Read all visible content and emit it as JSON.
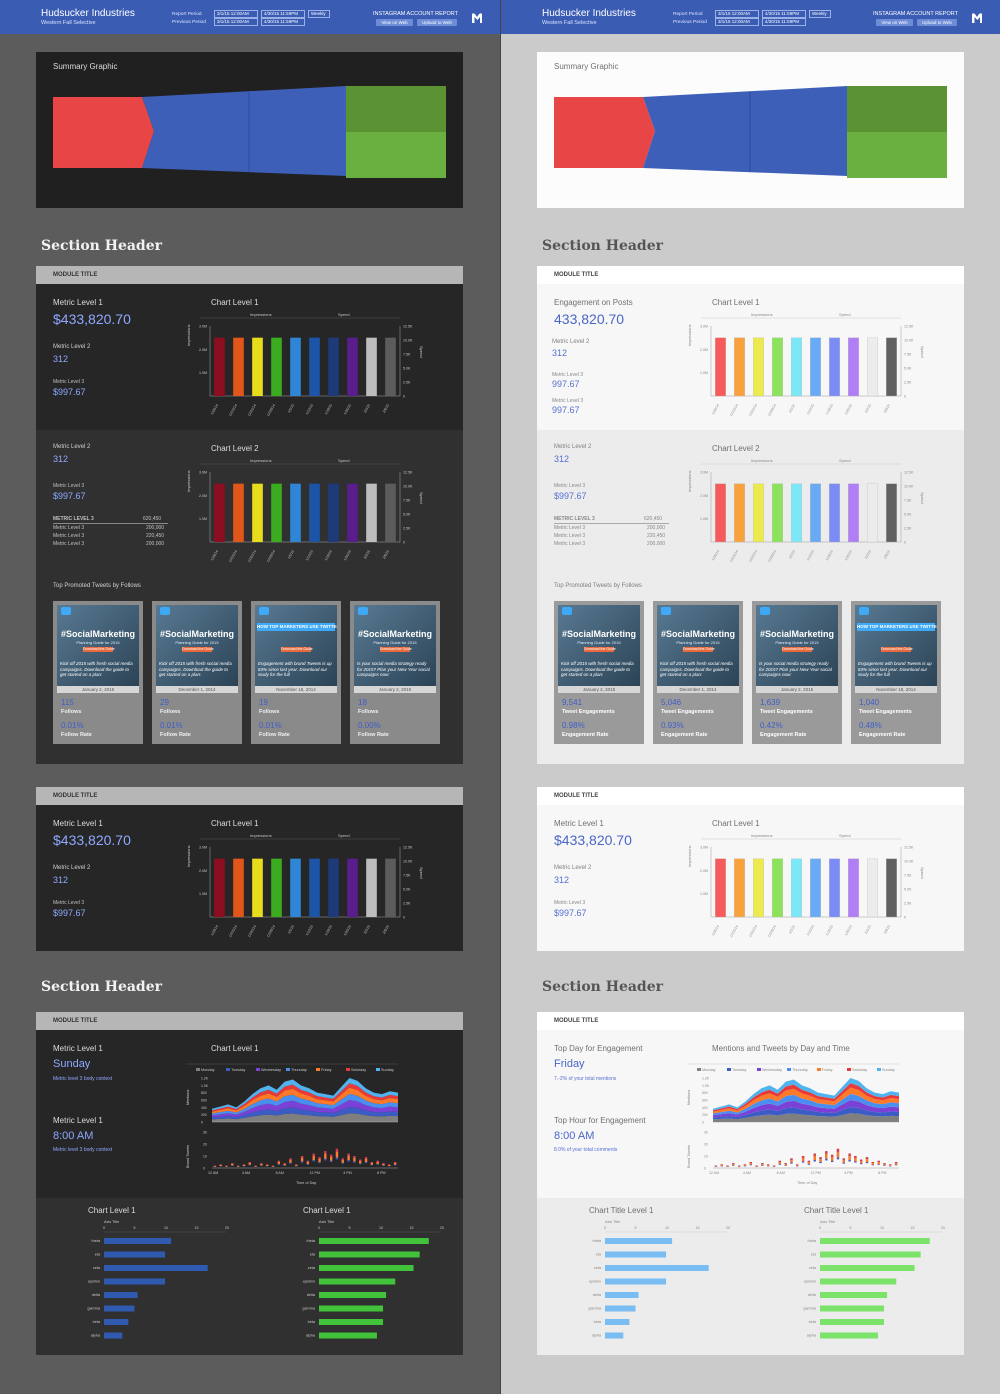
{
  "header": {
    "company": "Hudsucker Industries",
    "subtitle": "Western Fall Selective",
    "report_period_label": "Report Period",
    "previous_period_label": "Previous Period",
    "report_start": "3/1/15 12:00AM",
    "report_end": "4/30/15 11:59PM",
    "report_interval": "Weekly",
    "previous_start": "3/1/15 12:00AM",
    "previous_end": "4/30/15 11:59PM",
    "dark_report_title": "INSTAGRAM ACCOUNT REPORT",
    "light_report_title": "INSTAGRAM ACCOUNT REPORT",
    "view_web": "View on Web",
    "upload_web": "Upload to Web"
  },
  "summary": {
    "title": "Summary Graphic",
    "colors": {
      "red": "#e84646",
      "blue": "#3d5fb8",
      "green_dark": "#5a9234",
      "green_light": "#6ab040"
    }
  },
  "section_header_1": "Section Header",
  "section_header_2": "Section Header",
  "dark": {
    "module1": {
      "title": "MODULE TITLE",
      "m1_label": "Metric Level 1",
      "m1_value": "$433,820.70",
      "m2_label": "Metric Level 2",
      "m2_value": "312",
      "m3_label": "Metric Level 3",
      "m3_value": "$997.67",
      "chart1_title": "Chart Level 1",
      "row2_m2_label": "Metric Level 2",
      "row2_m2_value": "312",
      "row2_m3_label": "Metric Level 3",
      "row2_m3_value": "$997.67",
      "table_head_label": "METRIC LEVEL 3",
      "table_head_value": "620,450",
      "table": [
        {
          "label": "Metric Level 3",
          "value": "200,000"
        },
        {
          "label": "Metric Level 3",
          "value": "220,450"
        },
        {
          "label": "Metric Level 3",
          "value": "200,000"
        }
      ],
      "chart2_title": "Chart Level 2",
      "tweets_title": "Top Promoted Tweets by Follows",
      "tweets": [
        {
          "headline": "#SocialMarketing",
          "sub": "Planning Guide for 2015",
          "btn": "Download the Guide",
          "text": "Kick off 2015 with fresh social media campaigns. Download the guide to get started on a plan:",
          "date": "January 2, 2015",
          "n1": "115",
          "s1": "Follows",
          "n2": "0.01%",
          "s2": "Follow Rate"
        },
        {
          "headline": "#SocialMarketing",
          "sub": "Planning Guide for 2015",
          "btn": "Download the Guide",
          "text": "Kick off 2015 with fresh social media campaigns. Download the guide to get started on a plan:",
          "date": "December 1, 2014",
          "n1": "29",
          "s1": "Follows",
          "n2": "0.01%",
          "s2": "Follow Rate"
        },
        {
          "headline": "HOW TOP MARKETERS USE TWITTER",
          "sub": "",
          "btn": "Download the Guide",
          "text": "Engagement with brand Tweets is up 83% since last year. Download our study for the full",
          "date": "November 18, 2014",
          "n1": "19",
          "s1": "Follows",
          "n2": "0.01%",
          "s2": "Follow Rate"
        },
        {
          "headline": "#SocialMarketing",
          "sub": "Planning Guide for 2015",
          "btn": "Download the Guide",
          "text": "Is your social media strategy ready for 2015? Plan your New Year social campaigns now:",
          "date": "January 2, 2015",
          "n1": "18",
          "s1": "Follows",
          "n2": "0.00%",
          "s2": "Follow Rate"
        }
      ]
    },
    "module2": {
      "title": "MODULE TITLE",
      "m1_label": "Metric Level 1",
      "m1_value": "$433,820.70",
      "m2_label": "Metric Level 2",
      "m2_value": "312",
      "m3_label": "Metric Level 3",
      "m3_value": "$997.67",
      "chart_title": "Chart Level 1"
    },
    "module3": {
      "title": "MODULE TITLE",
      "a_label": "Metric Level 1",
      "a_value": "Sunday",
      "a_ctx": "Metric level 3 body context",
      "b_label": "Metric Level 1",
      "b_value": "8:00 AM",
      "b_ctx": "Metric level 3 body context",
      "chart_title": "Chart Level 1",
      "bar1_title": "Chart Level 1",
      "bar2_title": "Chart Level 1"
    }
  },
  "light": {
    "module1": {
      "title": "MODULE TITLE",
      "m1_label": "Engagement on Posts",
      "m1_value": "433,820.70",
      "m2_label": "Metric Level 2",
      "m2_value": "312",
      "m3_label": "Metric Level 3",
      "m3_value": "997.67",
      "m4_label": "Metric Level 3",
      "m4_value": "997.67",
      "chart1_title": "Chart Level 1",
      "row2_m2_label": "Metric Level 2",
      "row2_m2_value": "312",
      "row2_m3_label": "Metric Level 3",
      "row2_m3_value": "$997.67",
      "table_head_label": "METRIC LEVEL 3",
      "table_head_value": "620,450",
      "table": [
        {
          "label": "Metric Level 3",
          "value": "200,000"
        },
        {
          "label": "Metric Level 3",
          "value": "220,450"
        },
        {
          "label": "Metric Level 3",
          "value": "200,000"
        }
      ],
      "chart2_title": "Chart Level 2",
      "tweets_title": "Top Promoted Tweets by Follows",
      "tweets": [
        {
          "headline": "#SocialMarketing",
          "sub": "Planning Guide for 2015",
          "btn": "Download the Guide",
          "text": "Kick off 2015 with fresh social media campaigns. Download the guide to get started on a plan:",
          "date": "January 2, 2015",
          "n1": "9,541",
          "s1": "Tweet Engagements",
          "n2": "0.98%",
          "s2": "Engagement Rate"
        },
        {
          "headline": "#SocialMarketing",
          "sub": "Planning Guide for 2015",
          "btn": "Download the Guide",
          "text": "Kick off 2015 with fresh social media campaigns. Download the guide to get started on a plan:",
          "date": "December 1, 2014",
          "n1": "5,046",
          "s1": "Tweet Engagements",
          "n2": "0.93%",
          "s2": "Engagement Rate"
        },
        {
          "headline": "#SocialMarketing",
          "sub": "Planning Guide for 2015",
          "btn": "Download the Guide",
          "text": "Is your social media strategy ready for 2015? Plan your New Year social campaigns now:",
          "date": "January 2, 2015",
          "n1": "1,639",
          "s1": "Tweet Engagements",
          "n2": "0.42%",
          "s2": "Engagement Rate"
        },
        {
          "headline": "HOW TOP MARKETERS USE TWITTER",
          "sub": "",
          "btn": "Download the Guide",
          "text": "Engagement with brand Tweets is up 83% since last year. Download our study for the full",
          "date": "November 18, 2014",
          "n1": "1,040",
          "s1": "Tweet Engagements",
          "n2": "0.48%",
          "s2": "Engagement Rate"
        }
      ]
    },
    "module2": {
      "title": "MODULE TITLE",
      "m1_label": "Metric Level 1",
      "m1_value": "$433,820.70",
      "m2_label": "Metric Level 2",
      "m2_value": "312",
      "m3_label": "Metric Level 3",
      "m3_value": "$997.67",
      "chart_title": "Chart Level 1"
    },
    "module3": {
      "title": "MODULE TITLE",
      "a_label": "Top Day for Engagement",
      "a_value": "Friday",
      "a_ctx": "7.-2% of your total mentions",
      "b_label": "Top Hour for Engagement",
      "b_value": "8:00 AM",
      "b_ctx": "8.0% of your total comments",
      "chart_title": "Mentions and Tweets by Day and Time",
      "bar1_title": "Chart Title Level 1",
      "bar2_title": "Chart Title Level 1"
    }
  },
  "chart_data": [
    {
      "type": "bar",
      "legend": [
        "Impressions",
        "Spend"
      ],
      "ylabel": "Impressions",
      "y2label": "Spend",
      "yticks": [
        "3.0M",
        "2.0M",
        "1.0M"
      ],
      "y2ticks": [
        "12.5K",
        "10.0K",
        "7.5K",
        "5.0K",
        "2.5K",
        "0"
      ],
      "categories": [
        "12/8/14",
        "12/15/14",
        "12/22/14",
        "12/29/14",
        "1/5/15",
        "1/12/15",
        "1/19/15",
        "1/26/15",
        "2/2/15",
        "2/9/15"
      ],
      "values": [
        2.5,
        2.5,
        2.5,
        2.5,
        2.5,
        2.5,
        2.5,
        2.5,
        2.5,
        2.5
      ],
      "ylim": [
        0,
        3.0
      ],
      "dark_colors": [
        "#8b0f20",
        "#e2561b",
        "#e8dd1c",
        "#3bab20",
        "#2f86d6",
        "#1c54a8",
        "#1e3a78",
        "#5a1d8c",
        "#bdbdbd",
        "#5c5c5c"
      ],
      "light_colors": [
        "#f75a5a",
        "#f7a23e",
        "#ecea4e",
        "#8ce25a",
        "#7be7f7",
        "#6aaaf5",
        "#7b8cf7",
        "#b07ef5",
        "#ececec",
        "#606060"
      ]
    },
    {
      "type": "area",
      "legend": [
        "Monday",
        "Tuesday",
        "Wednesday",
        "Thursday",
        "Friday",
        "Saturday",
        "Sunday"
      ],
      "legend_colors": [
        "#7f7f7f",
        "#3b5cc4",
        "#7b41d6",
        "#4a8ff0",
        "#ff7a28",
        "#e83a3a",
        "#4fb3f0"
      ],
      "ylabel": "Mentions",
      "yticks": [
        "1.2K",
        "1.0K",
        "800",
        "600",
        "400",
        "200",
        "0"
      ],
      "x": [
        "12 AM",
        "4 AM",
        "8 AM",
        "12 PM",
        "4 PM",
        "8 PM"
      ],
      "xlabel": "Time of Day",
      "series_totals": [
        18,
        21,
        24,
        20,
        28,
        38,
        46,
        50,
        44,
        55,
        58,
        50,
        46,
        40,
        38,
        36,
        48,
        60,
        56,
        46,
        40,
        38,
        42,
        40
      ]
    },
    {
      "type": "bar",
      "subtype": "stacked",
      "ylabel": "Brand Tweets",
      "yticks": [
        "30",
        "20",
        "10",
        "0"
      ],
      "x": [
        "12 AM",
        "4 AM",
        "8 AM",
        "12 PM",
        "4 PM",
        "8 PM"
      ],
      "values": [
        2,
        3,
        2,
        4,
        2,
        3,
        5,
        2,
        4,
        3,
        2,
        6,
        4,
        8,
        3,
        10,
        6,
        12,
        9,
        14,
        11,
        16,
        8,
        12,
        10,
        7,
        9,
        5,
        6,
        4,
        3,
        5
      ]
    },
    {
      "type": "bar",
      "orientation": "horizontal",
      "xlabel": "Axis Title",
      "xticks": [
        "0",
        "5",
        "10",
        "15",
        "20"
      ],
      "categories": [
        "theta",
        "eta",
        "zeta",
        "epsilon",
        "delta",
        "gamma",
        "beta",
        "alpha"
      ],
      "values": [
        11,
        10,
        17,
        10,
        5.5,
        5,
        4,
        3
      ],
      "xlim": [
        0,
        20
      ]
    },
    {
      "type": "bar",
      "orientation": "horizontal",
      "xlabel": "Axis Title",
      "xticks": [
        "0",
        "5",
        "10",
        "15",
        "20"
      ],
      "categories": [
        "theta",
        "eta",
        "zeta",
        "epsilon",
        "delta",
        "gamma",
        "beta",
        "alpha"
      ],
      "values": [
        18,
        16.5,
        15.5,
        12.5,
        11,
        10.5,
        10.5,
        9.5
      ],
      "xlim": [
        0,
        20
      ]
    }
  ]
}
